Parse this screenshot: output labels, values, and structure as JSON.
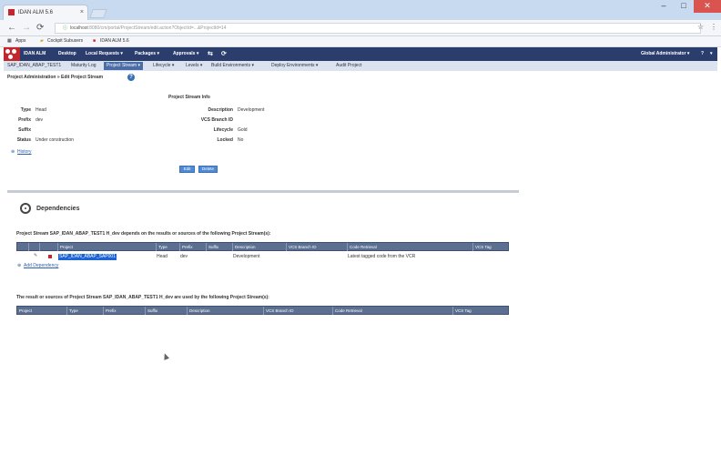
{
  "browser": {
    "tab_title": "IDAN ALM 5.6",
    "url_host": "localhost",
    "url_rest": ":8080/cm/portal/ProjectStream/edit.action?ObjectId=...&ProjectId=14",
    "controls": {
      "minimize": "–",
      "maximize": "□",
      "close": "✕"
    }
  },
  "bookmarks": {
    "apps": "Apps",
    "item1": "Cockpit Subusers",
    "item2": "IDAN ALM 5.6"
  },
  "menu": {
    "logo_text": "IDAN ALM",
    "items": [
      "Desktop",
      "Local Requests ▾",
      "Packages ▾",
      "Approvals ▾"
    ],
    "user": "Global Administrator ▾",
    "help": "?"
  },
  "submenu": [
    "SAP_IDAN_ABAP_TEST1",
    "Maturity Log",
    "Project Stream ▾",
    "Lifecycle ▾",
    "Levels ▾",
    "Build Environments ▾",
    "Deploy Environments ▾",
    "Audit Project"
  ],
  "breadcrumb": "Project Administration » Edit Project Stream",
  "info": {
    "title": "Project Stream Info",
    "left": [
      {
        "label": "Type",
        "value": "Head"
      },
      {
        "label": "Prefix",
        "value": "dev"
      },
      {
        "label": "Suffix",
        "value": ""
      },
      {
        "label": "Status",
        "value": "Under construction"
      }
    ],
    "right": [
      {
        "label": "Description",
        "value": "Development"
      },
      {
        "label": "VCS Branch ID",
        "value": ""
      },
      {
        "label": "Lifecycle",
        "value": "Gold"
      },
      {
        "label": "Locked",
        "value": "No"
      }
    ],
    "history": "History",
    "edit_button": "Edit",
    "delete_button": "Delete"
  },
  "dependencies": {
    "title": "Dependencies",
    "depends_on_text": "Project Stream SAP_IDAN_ABAP_TEST1 H_dev depends on the results or sources of the following Project Stream(s):",
    "table1_headers": [
      "Project",
      "Type",
      "Prefix",
      "Suffix",
      "Description",
      "VCS Branch ID",
      "Code Retrieval",
      "VCS Tag"
    ],
    "table1_row": {
      "project": "SAP_IDAN_ABAP_SAP001",
      "type": "Head",
      "prefix": "dev",
      "suffix": "",
      "description": "Development",
      "vcs_branch": "",
      "code_retrieval": "Latest tagged code from the VCR",
      "vcs_tag": ""
    },
    "add_link": "Add Dependency",
    "used_by_text": "The result or sources of Project Stream SAP_IDAN_ABAP_TEST1 H_dev are used by the following Project Stream(s):",
    "table2_headers": [
      "Project",
      "Type",
      "Prefix",
      "Suffix",
      "Description",
      "VCS Branch ID",
      "Code Retrieval",
      "VCS Tag"
    ]
  },
  "colors": {
    "menu_bar": "#2a3d6c",
    "accent": "#c1272d",
    "table_header": "#5c6f90",
    "selection": "#1b63d6"
  }
}
